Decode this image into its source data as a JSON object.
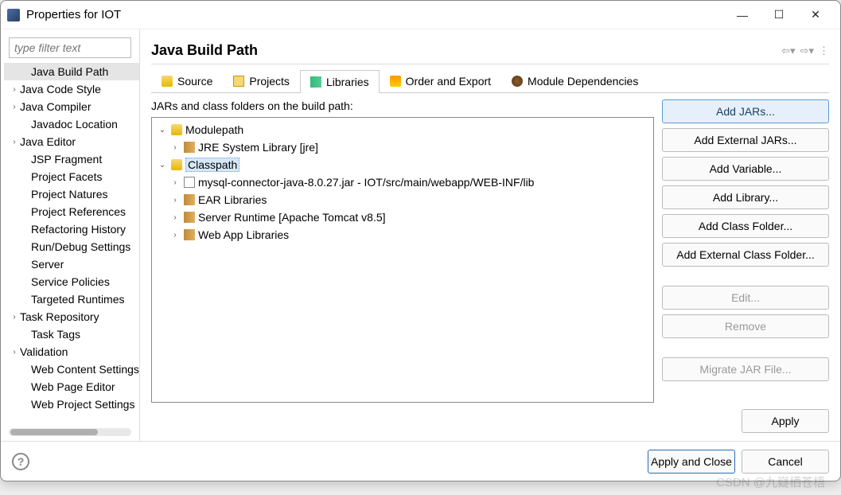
{
  "window": {
    "title": "Properties for IOT"
  },
  "sidebar": {
    "filter_placeholder": "type filter text",
    "items": [
      {
        "label": "Java Build Path",
        "expandable": false,
        "selected": true,
        "indent": true
      },
      {
        "label": "Java Code Style",
        "expandable": true
      },
      {
        "label": "Java Compiler",
        "expandable": true
      },
      {
        "label": "Javadoc Location",
        "expandable": false,
        "indent": true
      },
      {
        "label": "Java Editor",
        "expandable": true
      },
      {
        "label": "JSP Fragment",
        "expandable": false,
        "indent": true
      },
      {
        "label": "Project Facets",
        "expandable": false,
        "indent": true
      },
      {
        "label": "Project Natures",
        "expandable": false,
        "indent": true
      },
      {
        "label": "Project References",
        "expandable": false,
        "indent": true
      },
      {
        "label": "Refactoring History",
        "expandable": false,
        "indent": true
      },
      {
        "label": "Run/Debug Settings",
        "expandable": false,
        "indent": true
      },
      {
        "label": "Server",
        "expandable": false,
        "indent": true
      },
      {
        "label": "Service Policies",
        "expandable": false,
        "indent": true
      },
      {
        "label": "Targeted Runtimes",
        "expandable": false,
        "indent": true
      },
      {
        "label": "Task Repository",
        "expandable": true
      },
      {
        "label": "Task Tags",
        "expandable": false,
        "indent": true
      },
      {
        "label": "Validation",
        "expandable": true
      },
      {
        "label": "Web Content Settings",
        "expandable": false,
        "indent": true
      },
      {
        "label": "Web Page Editor",
        "expandable": false,
        "indent": true
      },
      {
        "label": "Web Project Settings",
        "expandable": false,
        "indent": true
      }
    ]
  },
  "page": {
    "title": "Java Build Path",
    "tabs": [
      {
        "label": "Source",
        "icon": "ic-source"
      },
      {
        "label": "Projects",
        "icon": "ic-projects"
      },
      {
        "label": "Libraries",
        "icon": "ic-lib",
        "active": true
      },
      {
        "label": "Order and Export",
        "icon": "ic-order"
      },
      {
        "label": "Module Dependencies",
        "icon": "ic-module"
      }
    ],
    "description": "JARs and class folders on the build path:",
    "tree": [
      {
        "label": "Modulepath",
        "level": 0,
        "arrow": "down",
        "icon": "ic-cp"
      },
      {
        "label": "JRE System Library [jre]",
        "level": 1,
        "arrow": "right",
        "icon": "ic-liby"
      },
      {
        "label": "Classpath",
        "level": 0,
        "arrow": "down",
        "icon": "ic-cp",
        "selected": true
      },
      {
        "label": "mysql-connector-java-8.0.27.jar - IOT/src/main/webapp/WEB-INF/lib",
        "level": 1,
        "arrow": "right",
        "icon": "ic-file"
      },
      {
        "label": "EAR Libraries",
        "level": 1,
        "arrow": "right",
        "icon": "ic-liby"
      },
      {
        "label": "Server Runtime [Apache Tomcat v8.5]",
        "level": 1,
        "arrow": "right",
        "icon": "ic-liby"
      },
      {
        "label": "Web App Libraries",
        "level": 1,
        "arrow": "right",
        "icon": "ic-liby"
      }
    ],
    "buttons": [
      {
        "label": "Add JARs...",
        "state": "hl"
      },
      {
        "label": "Add External JARs..."
      },
      {
        "label": "Add Variable..."
      },
      {
        "label": "Add Library..."
      },
      {
        "label": "Add Class Folder..."
      },
      {
        "label": "Add External Class Folder..."
      },
      {
        "label": "Edit...",
        "state": "disabled",
        "gap": true
      },
      {
        "label": "Remove",
        "state": "disabled"
      },
      {
        "label": "Migrate JAR File...",
        "state": "disabled",
        "gap": true
      }
    ],
    "apply_label": "Apply"
  },
  "footer": {
    "apply_close": "Apply and Close",
    "cancel": "Cancel"
  },
  "watermark": "CSDN @九嶷栖苍梧"
}
